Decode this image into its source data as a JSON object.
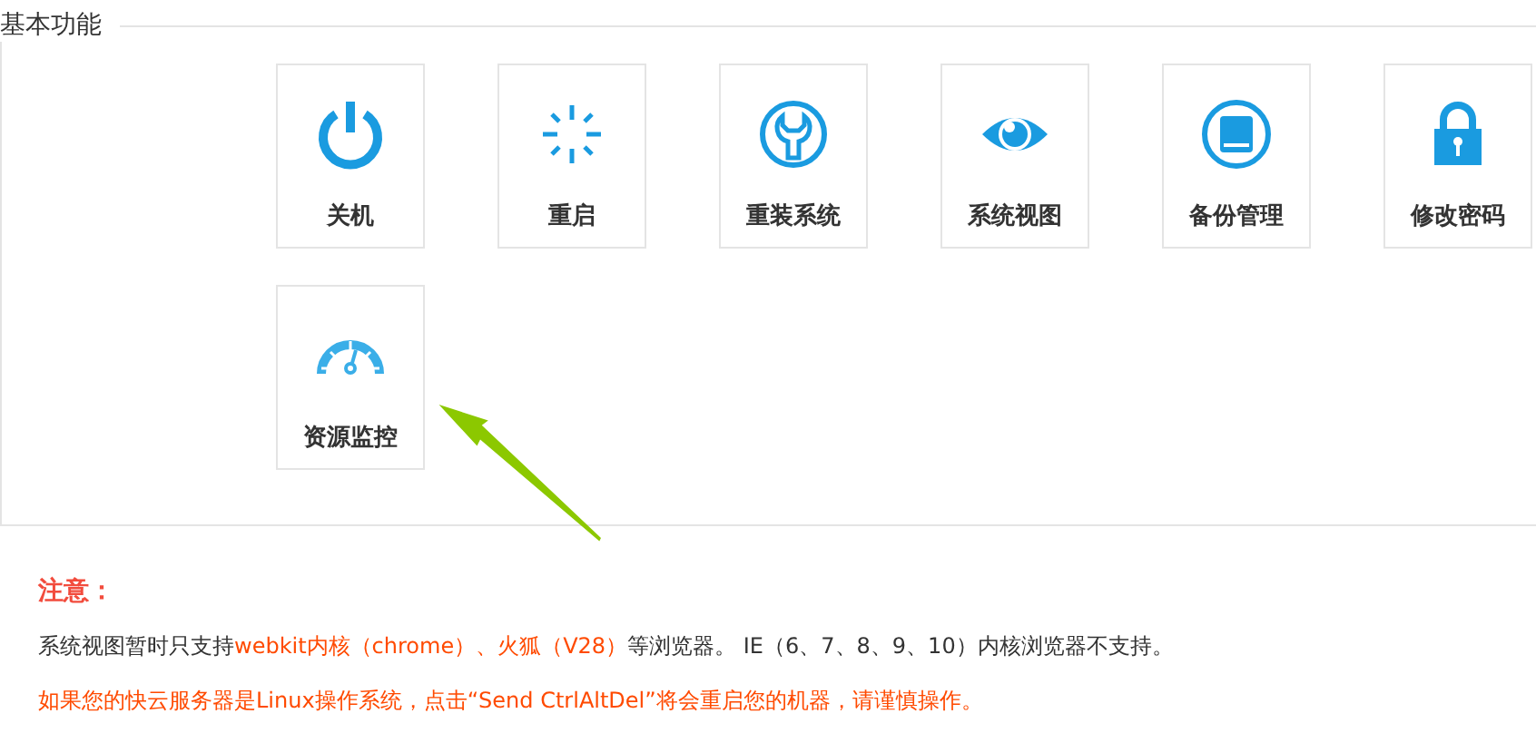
{
  "section": {
    "title": "基本功能"
  },
  "tools": [
    {
      "kind": "power",
      "label": "关机"
    },
    {
      "kind": "restart",
      "label": "重启"
    },
    {
      "kind": "reinstall",
      "label": "重装系统"
    },
    {
      "kind": "view",
      "label": "系统视图"
    },
    {
      "kind": "backup",
      "label": "备份管理"
    },
    {
      "kind": "password",
      "label": "修改密码"
    },
    {
      "kind": "monitor",
      "label": "资源监控"
    }
  ],
  "notice": {
    "title": "注意：",
    "lines": [
      [
        {
          "kind": "plain",
          "text": "系统视图暂时只支持"
        },
        {
          "kind": "highlight",
          "text": "webkit内核（chrome）、火狐（V28）"
        },
        {
          "kind": "plain",
          "text": "等浏览器。 IE（6、7、8、9、10）内核浏览器不支持。"
        }
      ],
      [
        {
          "kind": "highlight",
          "text": "如果您的快云服务器是Linux操作系统，点击“Send CtrlAltDel”将会重启您的机器，请谨慎操作。"
        }
      ]
    ]
  }
}
